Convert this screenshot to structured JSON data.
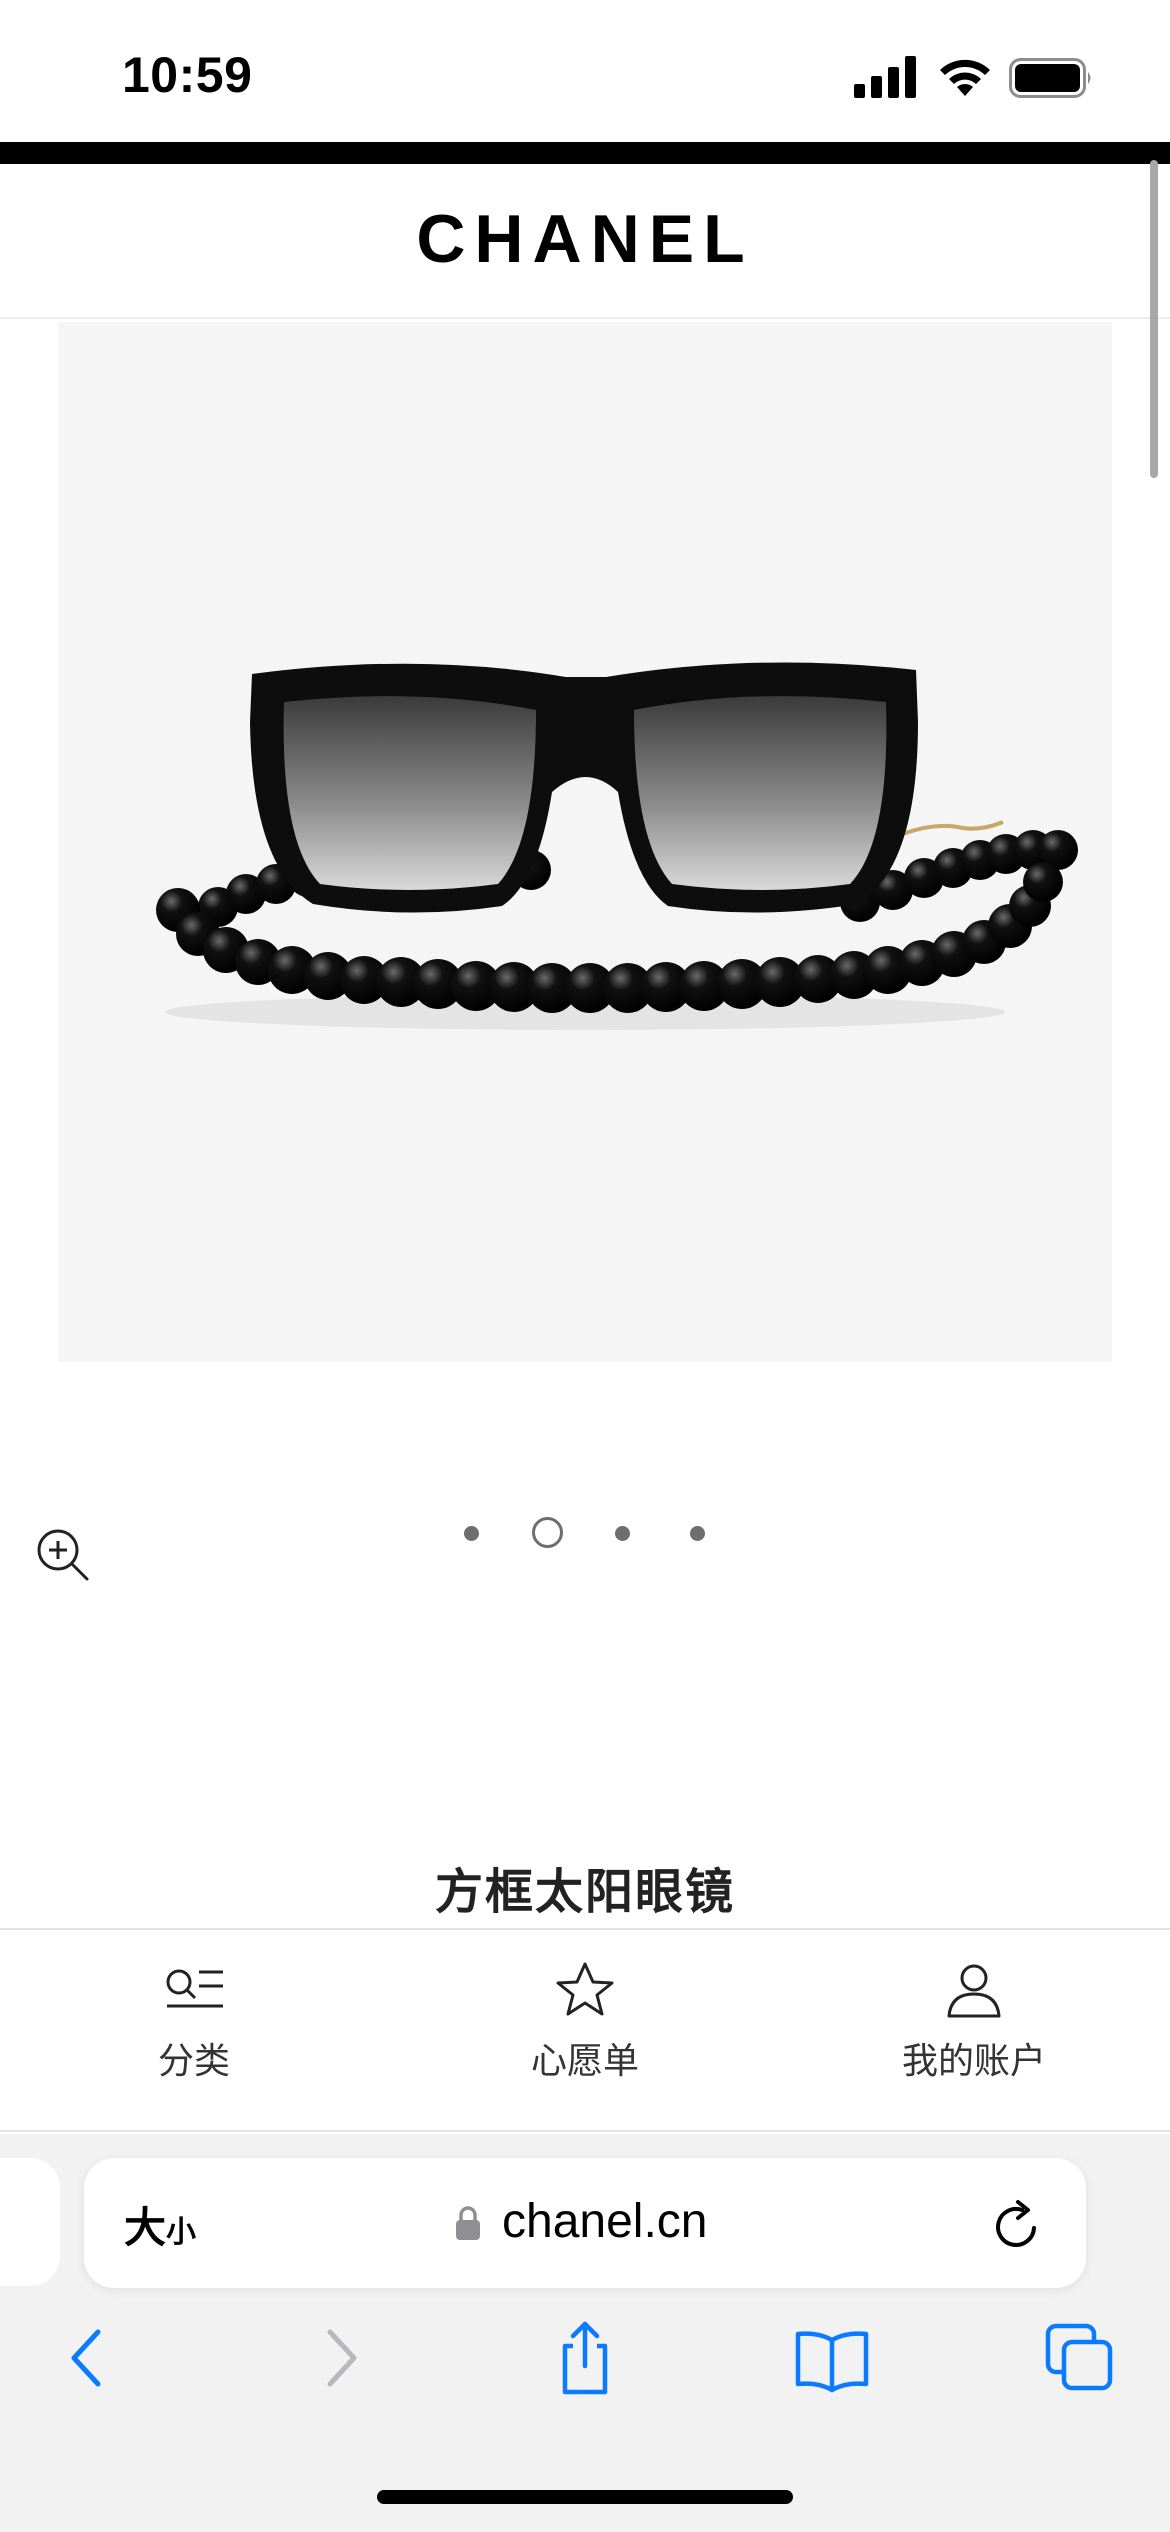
{
  "status_bar": {
    "time": "10:59",
    "icons": [
      "signal-icon",
      "wifi-icon",
      "battery-icon"
    ]
  },
  "header": {
    "brand": "CHANEL"
  },
  "product": {
    "image_subject": "sunglasses-with-pearl-chain",
    "title": "方框太阳眼镜",
    "carousel": {
      "total": 4,
      "active_index": 1
    }
  },
  "bottom_nav": {
    "items": [
      {
        "label": "分类",
        "icon": "category-list-icon"
      },
      {
        "label": "心愿单",
        "icon": "star-icon"
      },
      {
        "label": "我的账户",
        "icon": "person-icon"
      }
    ]
  },
  "browser": {
    "text_size_big": "大",
    "text_size_small": "小",
    "url": "chanel.cn",
    "toolbar": [
      "back-icon",
      "forward-icon",
      "share-icon",
      "bookmarks-icon",
      "tabs-icon"
    ]
  },
  "colors": {
    "accent": "#0a7aff",
    "image_bg": "#f5f5f5",
    "disabled": "#b8b8bd"
  }
}
